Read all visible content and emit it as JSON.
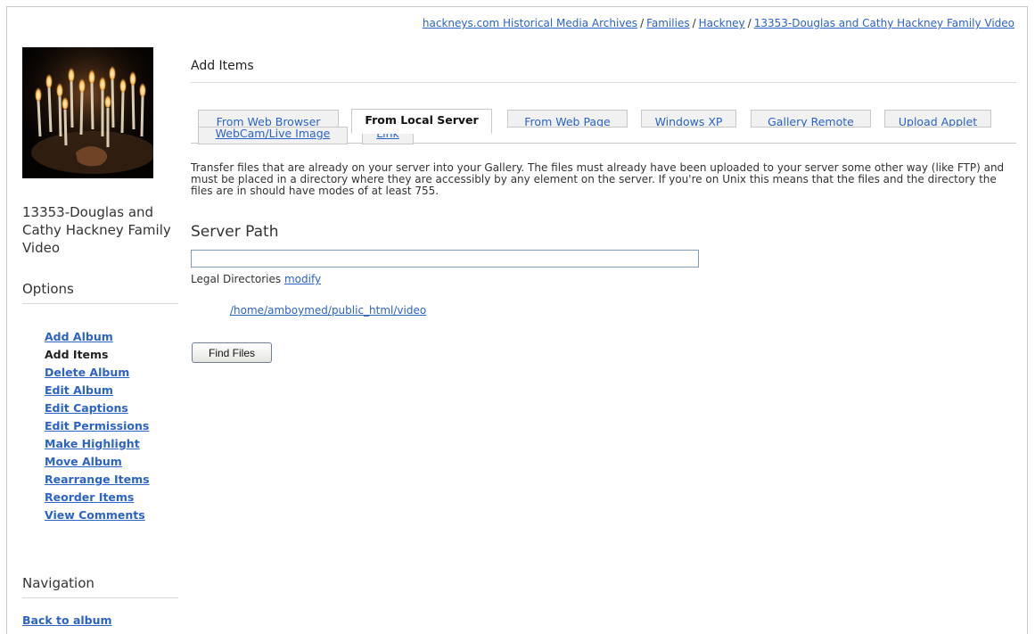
{
  "breadcrumb": {
    "items": [
      "hackneys.com Historical Media Archives",
      "Families",
      "Hackney",
      "13353-Douglas and Cathy Hackney Family Video"
    ],
    "separator": "/"
  },
  "sidebar": {
    "album_title": "13353-Douglas and Cathy Hackney Family Video",
    "options_heading": "Options",
    "options": [
      {
        "label": "Add Album",
        "current": false
      },
      {
        "label": "Add Items",
        "current": true
      },
      {
        "label": "Delete Album",
        "current": false
      },
      {
        "label": "Edit Album",
        "current": false
      },
      {
        "label": "Edit Captions",
        "current": false
      },
      {
        "label": "Edit Permissions",
        "current": false
      },
      {
        "label": "Make Highlight",
        "current": false
      },
      {
        "label": "Move Album",
        "current": false
      },
      {
        "label": "Rearrange Items",
        "current": false
      },
      {
        "label": "Reorder Items",
        "current": false
      },
      {
        "label": "View Comments",
        "current": false
      }
    ],
    "navigation_heading": "Navigation",
    "back_link": "Back to album"
  },
  "main": {
    "title": "Add Items",
    "tabs": [
      {
        "label": "From Web Browser",
        "active": false
      },
      {
        "label": "From Local Server",
        "active": true
      },
      {
        "label": "From Web Page",
        "active": false
      },
      {
        "label": "Windows XP",
        "active": false
      },
      {
        "label": "Gallery Remote",
        "active": false
      },
      {
        "label": "Upload Applet",
        "active": false
      },
      {
        "label": "WebCam/Live Image",
        "active": false
      },
      {
        "label": "Link",
        "active": false
      }
    ],
    "description": "Transfer files that are already on your server into your Gallery. The files must already have been uploaded to your server some other way (like FTP) and must be placed in a directory where they are accessibly by any element on the server. If you're on Unix this means that the files and the directory the files are in should have modes of at least 755.",
    "server_path_heading": "Server Path",
    "server_path_value": "",
    "legal_directories_label": "Legal Directories",
    "modify_link": "modify",
    "legal_directories": [
      "/home/amboymed/public_html/video"
    ],
    "find_files_button": "Find Files"
  },
  "colors": {
    "link": "#2b63c9",
    "tab_background": "#f1f1f1",
    "border": "#c8c8c8"
  }
}
